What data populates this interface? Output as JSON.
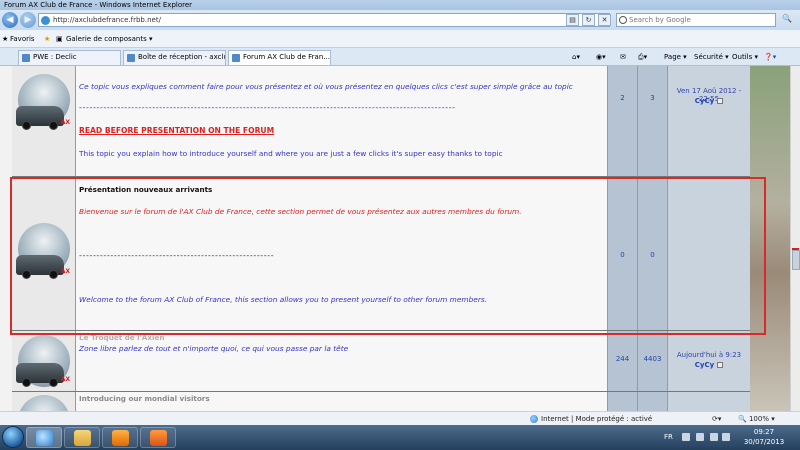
{
  "window": {
    "title": "Forum AX Club de France - Windows Internet Explorer"
  },
  "addressbar": {
    "url": "http://axclubdefrance.frbb.net/",
    "search_placeholder": "Search by Google"
  },
  "favorites": {
    "label": "Favoris",
    "items": [
      "Galerie de composants ▾"
    ]
  },
  "tabs": [
    {
      "label": "PWE : Declic",
      "active": false
    },
    {
      "label": "Boîte de réception - axclub...",
      "active": false
    },
    {
      "label": "Forum AX Club de Fran...",
      "active": true
    }
  ],
  "commandbar": {
    "page": "Page ▾",
    "security": "Sécurité ▾",
    "tools": "Outils ▾"
  },
  "forum_rows": [
    {
      "lines": [
        "Ce topic vous expliques comment faire pour vous présentez et où vous présentez en quelques clics c'est super simple grâce au topic",
        "------------------------------------------------------------------------------------------------------------",
        "READ BEFORE PRESENTATION ON THE FORUM",
        "This topic you explain how to introduce yourself and where you are just a few clicks it's super easy thanks to topic"
      ],
      "topics": "2",
      "posts": "3",
      "last_date": "Ven 17 Aoû 2012 - 22:55",
      "last_user": "CyCy"
    },
    {
      "title": "Présentation nouveaux arrivants",
      "lines": [
        "Bienvenue sur le forum de l'AX Club de France, cette section permet de vous présentez aux autres membres du forum.",
        "--------------------------------------------------------",
        "Welcome to the forum AX Club of France, this section allows you to present yourself to other forum members."
      ],
      "topics": "0",
      "posts": "0"
    },
    {
      "title": "Le Troquet de l'Axien",
      "lines": [
        "Zone libre parlez de tout et n'importe quoi, ce qui vous passe par la tête"
      ],
      "topics": "244",
      "posts": "4403",
      "last_date": "Aujourd'hui à 9:23",
      "last_user": "CyCy"
    },
    {
      "title": "Introducing our mondial visitors"
    }
  ],
  "statusbar": {
    "zone": "Internet | Mode protégé : activé",
    "zoom": "100%"
  },
  "taskbar": {
    "lang": "FR",
    "time": "09:27",
    "date": "30/07/2013"
  },
  "colors": {
    "accent_red": "#d92a2a",
    "link_blue": "#3333cc",
    "stat_cell": "#b5c3d2"
  }
}
